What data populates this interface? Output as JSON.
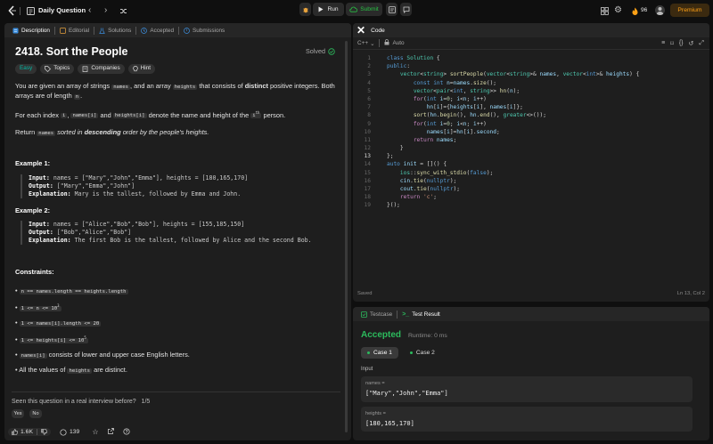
{
  "topbar": {
    "title": "Daily Question",
    "run": "Run",
    "submit": "Submit",
    "streak": "96",
    "premium": "Premium"
  },
  "left": {
    "tabs": [
      "Description",
      "Editorial",
      "Solutions",
      "Accepted",
      "Submissions"
    ],
    "title": "2418. Sort the People",
    "status": "Solved",
    "difficulty": "Easy",
    "topics": "Topics",
    "companies": "Companies",
    "hint": "Hint",
    "p1a": "You are given an array of strings ",
    "names": "names",
    "p1b": ", and an array ",
    "heights": "heights",
    "p1c": " that consists of ",
    "distinct": "distinct",
    "p1d": " positive integers. Both arrays are of length ",
    "n": "n",
    "p2a": "For each index ",
    "i": "i",
    "names_i": "names[i]",
    "p2b": " and ",
    "heights_i": "heights[i]",
    "p2c": " denote the name and height of the ",
    "ith": "i",
    "th": "th",
    "p2d": " person.",
    "p3a": "Return ",
    "p3b": " sorted in ",
    "descending": "descending",
    "p3c": " order by the people's heights.",
    "ex1_title": "Example 1:",
    "ex1_input": "names = [\"Mary\",\"John\",\"Emma\"], heights = [180,165,170]",
    "ex1_output": "[\"Mary\",\"Emma\",\"John\"]",
    "ex1_expl": "Mary is the tallest, followed by Emma and John.",
    "ex2_title": "Example 2:",
    "ex2_input": "names = [\"Alice\",\"Bob\",\"Bob\"], heights = [155,185,150]",
    "ex2_output": "[\"Bob\",\"Alice\",\"Bob\"]",
    "ex2_expl": "The first Bob is the tallest, followed by Alice and the second Bob.",
    "lbl_input": "Input:",
    "lbl_output": "Output:",
    "lbl_expl": "Explanation:",
    "constraints_title": "Constraints:",
    "c1": "n == names.length == heights.length",
    "c2": "1 <= n <= 10",
    "c2sup": "3",
    "c3": "1 <= names[i].length <= 20",
    "c4": "1 <= heights[i] <= 10",
    "c4sup": "5",
    "c5code": "names[i]",
    "c5": " consists of lower and upper case English letters.",
    "c6a": "All the values of ",
    "c6code": "heights",
    "c6b": " are distinct.",
    "interview_q": "Seen this question in a real interview before?",
    "interview_page": "1/5",
    "yes": "Yes",
    "no": "No",
    "likes": "1.6K",
    "comments": "139"
  },
  "editor": {
    "tab": "Code",
    "lang": "C++",
    "mode": "Auto",
    "saved": "Saved",
    "cursor": "Ln 13, Col 2",
    "lines": [
      "1",
      "2",
      "3",
      "4",
      "5",
      "6",
      "7",
      "8",
      "9",
      "10",
      "11",
      "12",
      "13",
      "14",
      "15",
      "16",
      "17",
      "18",
      "19"
    ]
  },
  "bottom": {
    "tabs": [
      "Testcase",
      "Test Result"
    ],
    "accepted": "Accepted",
    "runtime": "Runtime: 0 ms",
    "case1": "Case 1",
    "case2": "Case 2",
    "input_label": "Input",
    "names_label": "names =",
    "names_value": "[\"Mary\",\"John\",\"Emma\"]",
    "heights_label": "heights =",
    "heights_value": "[180,165,170]"
  },
  "colors": {
    "accent": "#ffa116",
    "green": "#2cbb5d",
    "submit": "#28c244"
  }
}
